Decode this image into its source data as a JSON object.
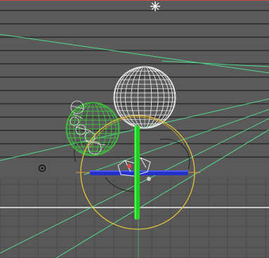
{
  "viewport": {
    "colors": {
      "background": "#5a5a5a",
      "stripe": "#222222",
      "floor": "#585858",
      "ground_line": "#f0f0f0",
      "wire_white": "#eeeeee",
      "wire_green": "#3ec33e",
      "green_pole": "#22cc22",
      "blue_bar": "#2330cc",
      "gizmo_yellow": "#e7c53a",
      "guide_lines": "#53d98e",
      "active_border": "#cc4b4b"
    },
    "icons": {
      "light_marker": "star-icon",
      "camera_marker": "target-icon"
    }
  }
}
